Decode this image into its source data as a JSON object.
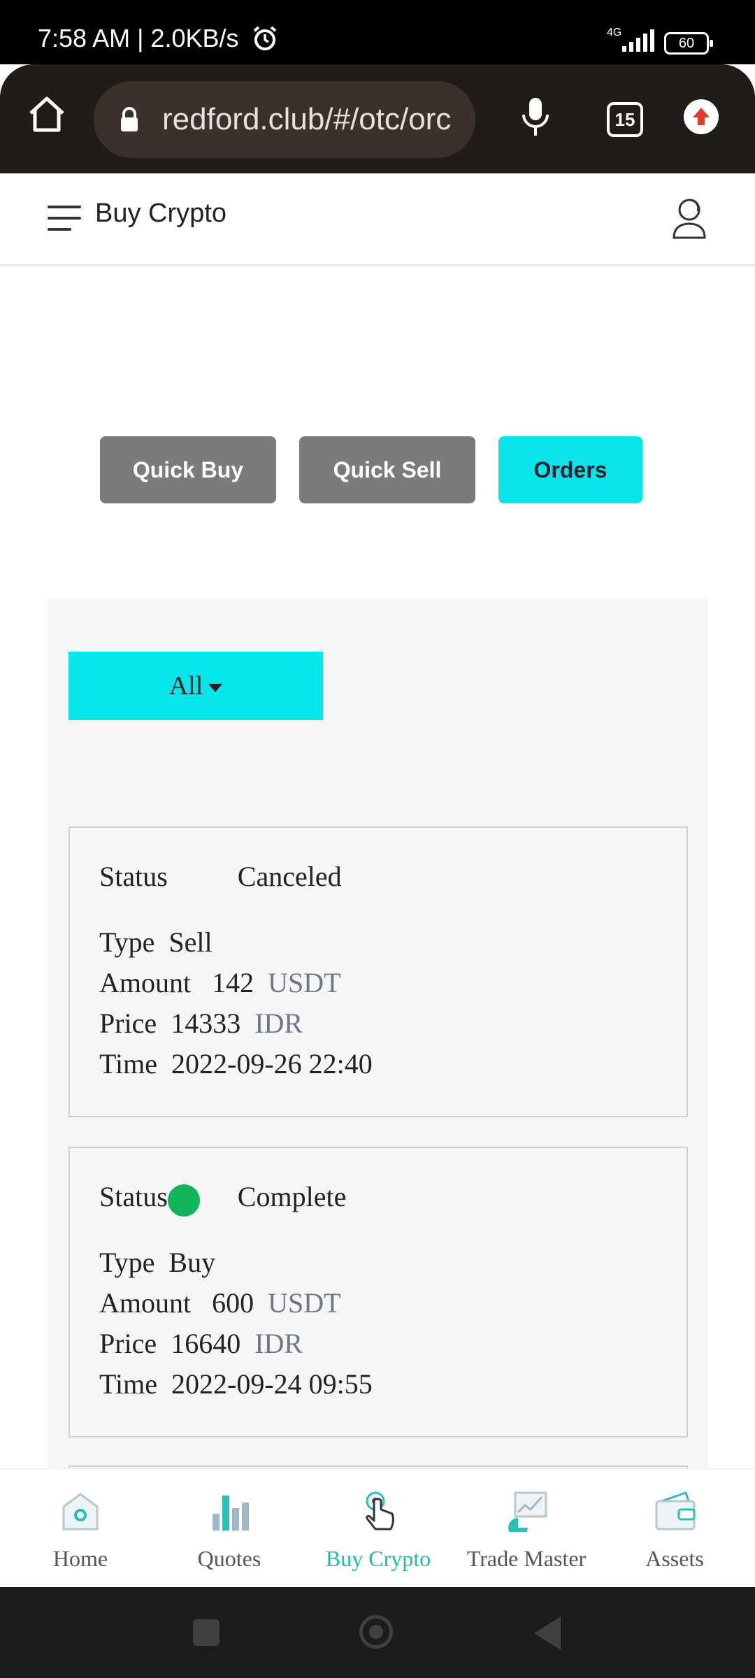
{
  "status_bar": {
    "time": "7:58 AM | 2.0KB/s",
    "network": "4G",
    "battery": "60"
  },
  "browser": {
    "url": "redford.club/#/otc/orc",
    "tab_count": "15"
  },
  "header": {
    "title": "Buy Crypto"
  },
  "tabs": {
    "quick_buy": "Quick Buy",
    "quick_sell": "Quick Sell",
    "orders": "Orders"
  },
  "filter": {
    "selected": "All"
  },
  "orders": [
    {
      "status_label": "Status",
      "status": "Canceled",
      "type_label": "Type",
      "type": "Sell",
      "amount_label": "Amount",
      "amount": "142",
      "amount_unit": "USDT",
      "price_label": "Price",
      "price": "14333",
      "price_unit": "IDR",
      "time_label": "Time",
      "time": "2022-09-26 22:40"
    },
    {
      "status_label": "Status",
      "status": "Complete",
      "status_color": "#11b55c",
      "type_label": "Type",
      "type": "Buy",
      "amount_label": "Amount",
      "amount": "600",
      "amount_unit": "USDT",
      "price_label": "Price",
      "price": "16640",
      "price_unit": "IDR",
      "time_label": "Time",
      "time": "2022-09-24 09:55"
    }
  ],
  "bottom_nav": [
    {
      "label": "Home",
      "icon": "home-icon"
    },
    {
      "label": "Quotes",
      "icon": "chart-bars-icon"
    },
    {
      "label": "Buy Crypto",
      "icon": "touch-hand-icon"
    },
    {
      "label": "Trade Master",
      "icon": "trade-chart-icon"
    },
    {
      "label": "Assets",
      "icon": "wallet-icon"
    }
  ],
  "colors": {
    "accent": "#05e5ea",
    "active_nav": "#1fb9b2",
    "tab_inactive": "#7b7b7b"
  }
}
